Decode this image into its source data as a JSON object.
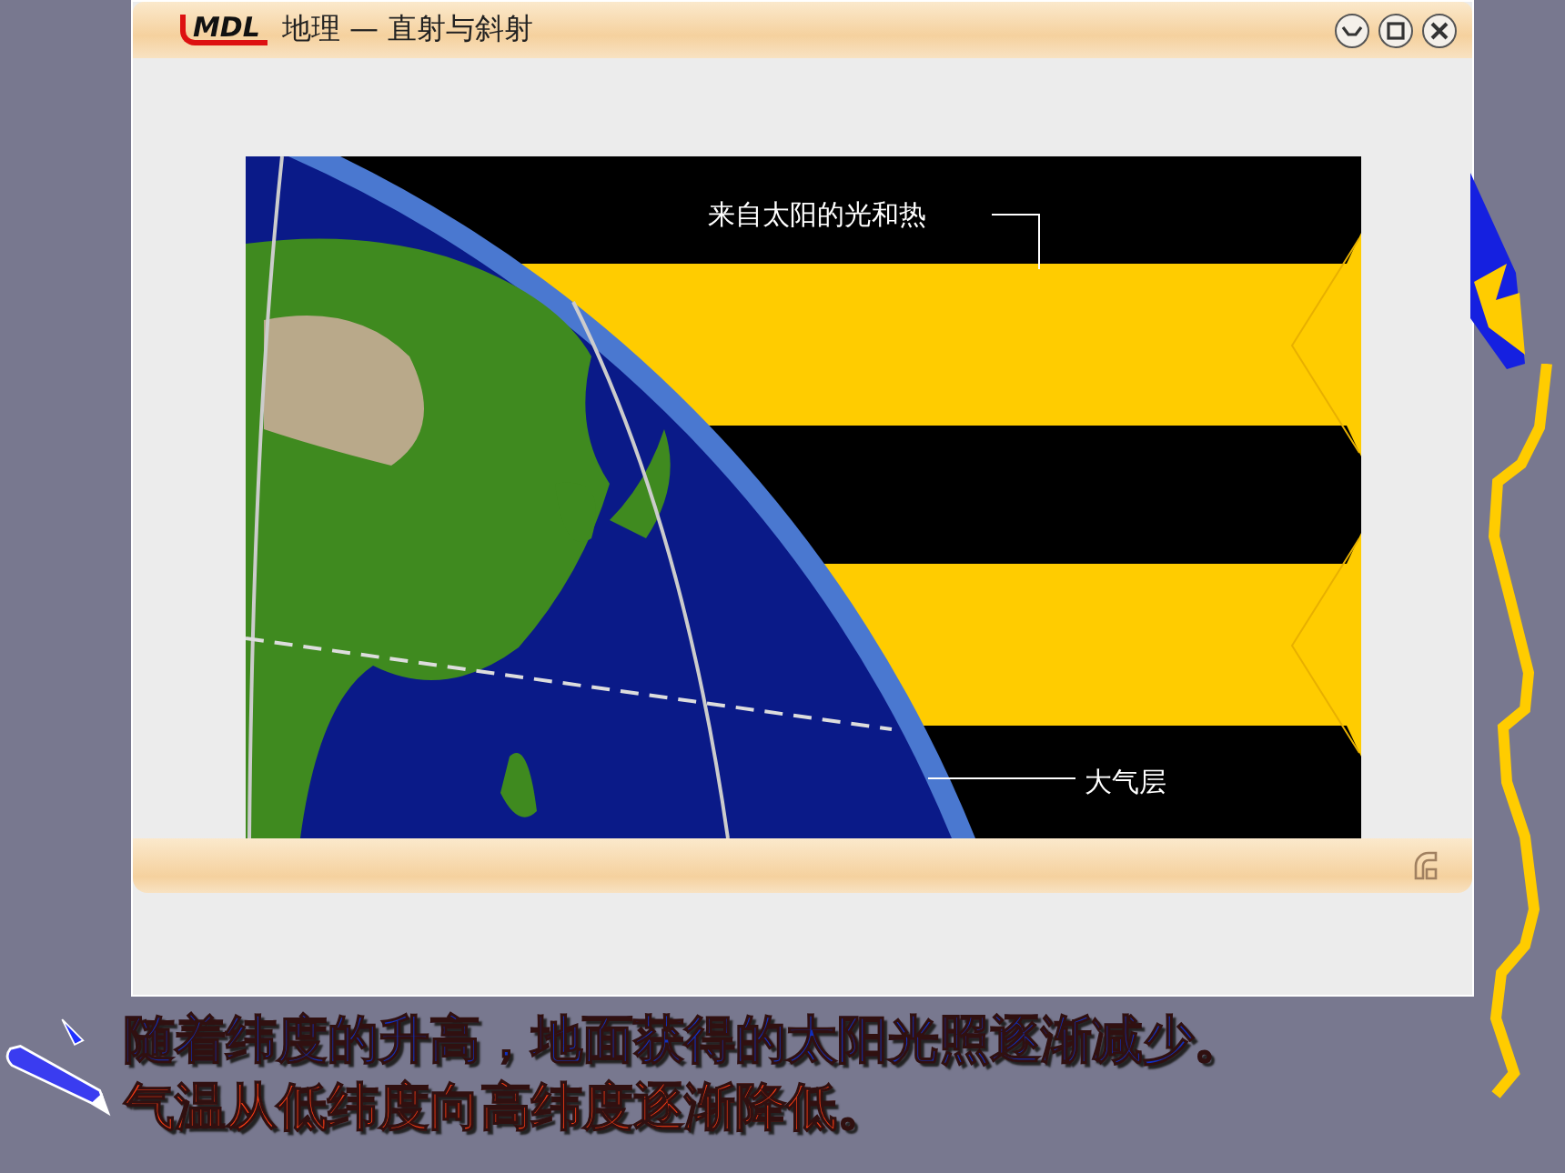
{
  "window": {
    "logo": "MDL",
    "title": "地理 — 直射与斜射"
  },
  "diagram": {
    "labels": [
      {
        "kind": "sunlight",
        "text": "来自太阳的光和热"
      },
      {
        "kind": "atmosphere",
        "text": "大气层"
      }
    ]
  },
  "caption": [
    {
      "text": "随着纬度的升高，地面获得的太阳光照逐渐减少。",
      "color": "#1030c0"
    },
    {
      "text": "气温从低纬度向高纬度逐渐降低。",
      "color": "#ff3c14"
    }
  ]
}
